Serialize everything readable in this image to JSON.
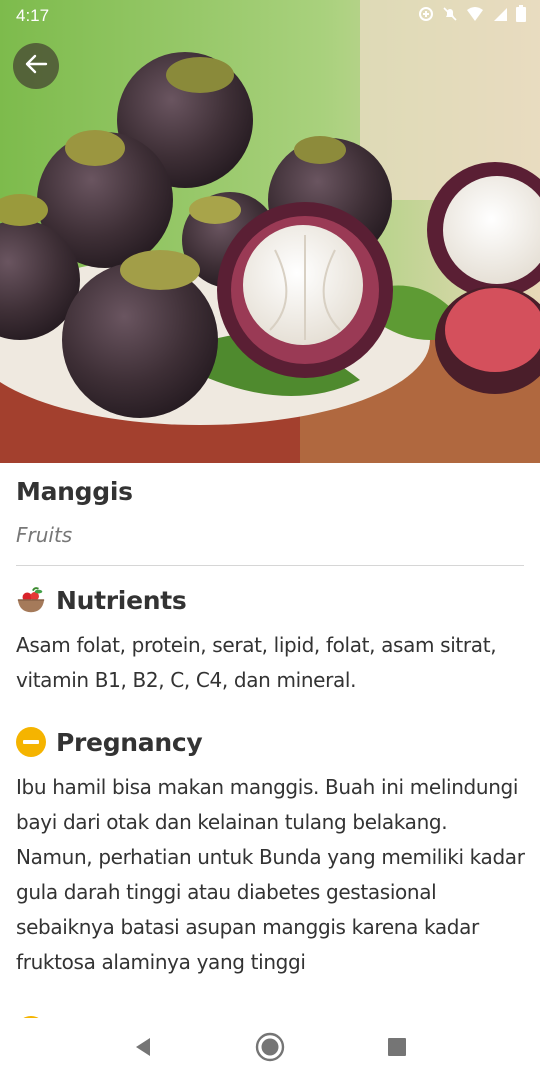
{
  "status_bar": {
    "time": "4:17",
    "icons": [
      "data-saver-icon",
      "bell-off-icon",
      "wifi-icon",
      "signal-icon",
      "battery-icon"
    ]
  },
  "hero": {
    "image": "mangosteen-fruit-photo"
  },
  "item": {
    "title": "Manggis",
    "category": "Fruits"
  },
  "sections": {
    "nutrients": {
      "title": "Nutrients",
      "icon": "fruit-bowl-icon",
      "body": "Asam folat, protein, serat, lipid, folat, asam sitrat, vitamin B1, B2, C, C4, dan mineral."
    },
    "pregnancy": {
      "title": "Pregnancy",
      "icon": "caution-minus-icon",
      "icon_color": "#F5B400",
      "body": "Ibu hamil bisa makan manggis. Buah ini melindungi bayi dari otak dan kelainan tulang belakang. Namun, perhatian untuk Bunda yang memiliki kadar gula darah tinggi atau diabetes gestasional sebaiknya batasi asupan manggis karena kadar fruktosa alaminya yang tinggi"
    }
  },
  "nav": {
    "back": "back-triangle-icon",
    "home": "home-circle-icon",
    "recents": "recents-square-icon"
  }
}
